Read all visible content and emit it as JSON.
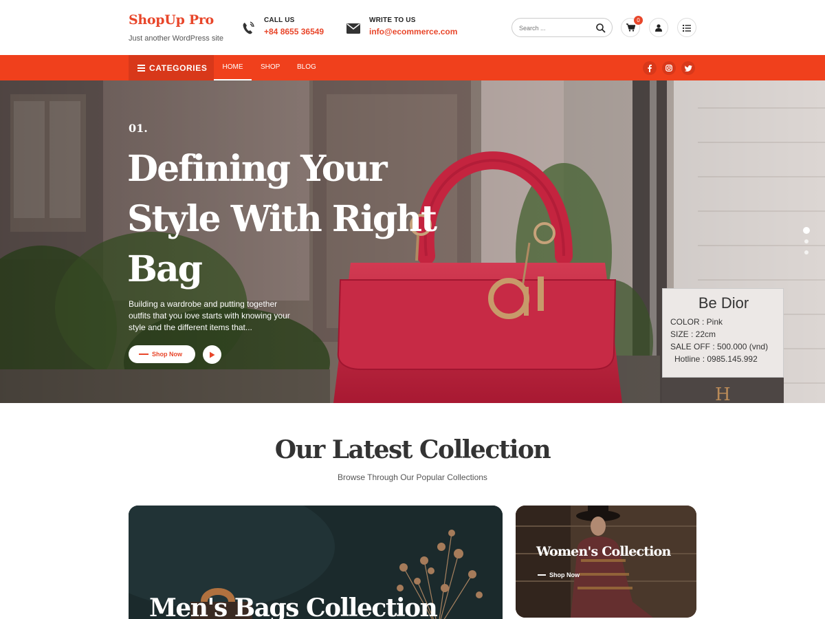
{
  "brand": {
    "title": "ShopUp Pro",
    "tagline": "Just another WordPress site"
  },
  "contacts": {
    "phone": {
      "label": "CALL US",
      "value": "+84 8655 36549",
      "icon": "phone-icon"
    },
    "email": {
      "label": "WRITE TO US",
      "value": "info@ecommerce.com",
      "icon": "envelope-icon"
    }
  },
  "search": {
    "placeholder": "Search ..."
  },
  "cart": {
    "count": "0"
  },
  "nav": {
    "categories_label": "CATEGORIES",
    "items": [
      {
        "label": "HOME",
        "active": true
      },
      {
        "label": "SHOP",
        "active": false
      },
      {
        "label": "BLOG",
        "active": false
      }
    ],
    "social": [
      "facebook-icon",
      "instagram-icon",
      "twitter-icon"
    ]
  },
  "hero": {
    "slide_number": "01.",
    "title": "Defining Your Style With Right Bag",
    "description": "Building a wardrobe and putting together outfits that you love starts with knowing your style and the different items that...",
    "cta_label": "Shop Now",
    "slides_total": 3,
    "active_slide": 1,
    "sign": {
      "brand": "Be Dior",
      "lines": [
        "COLOR    : Pink",
        "SIZE       : 22cm",
        "SALE OFF : 500.000 (vnd)",
        "Hotline : 0985.145.992"
      ]
    }
  },
  "collection": {
    "title": "Our Latest Collection",
    "subtitle": "Browse Through Our Popular Collections",
    "cards": [
      {
        "title": "Men's Bags Collection",
        "cta_label": ""
      },
      {
        "title": "Women's Collection",
        "cta_label": "Shop Now"
      }
    ]
  },
  "colors": {
    "accent": "#f0401c",
    "accent_dark": "#d8381a",
    "bag": "#c4243f"
  }
}
